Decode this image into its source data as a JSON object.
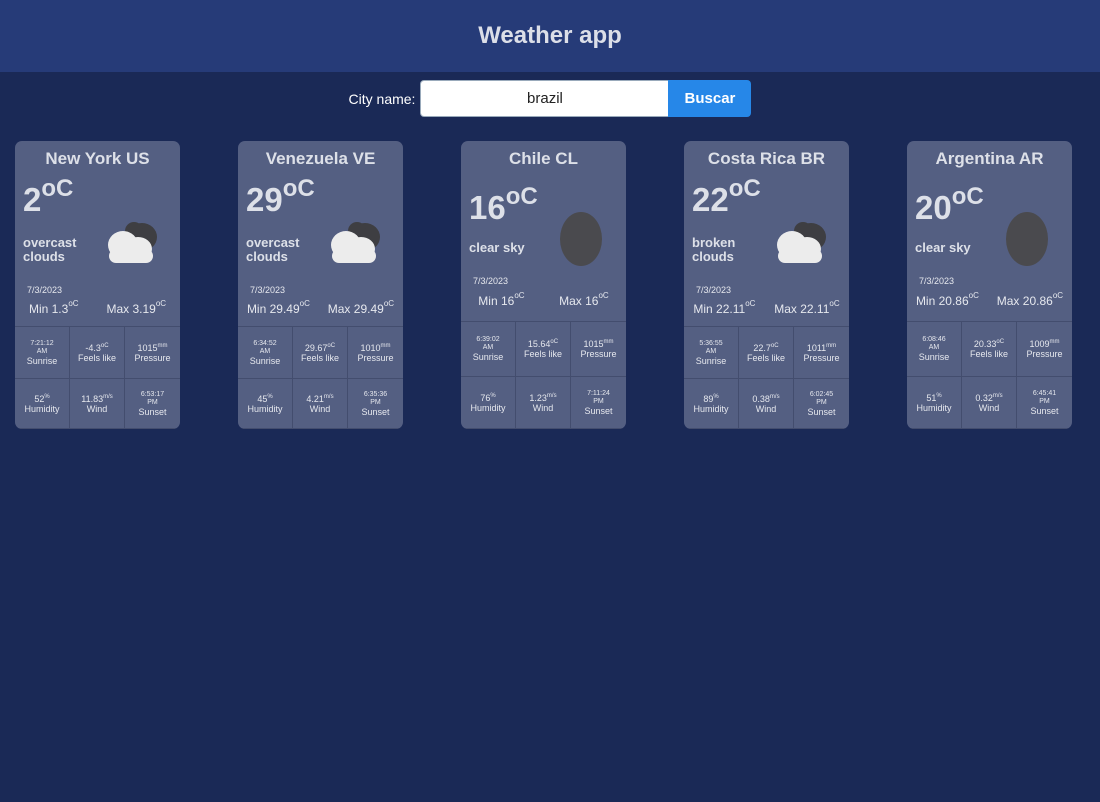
{
  "app": {
    "title": "Weather app"
  },
  "search": {
    "label": "City name:",
    "value": "brazil",
    "button": "Buscar"
  },
  "cards": [
    {
      "city": "New York US",
      "temp": "2",
      "unit": "oC",
      "desc": "overcast clouds",
      "icon": "cloud-icon",
      "date": "7/3/2023",
      "min": "Min 1.3",
      "max": "Max 3.19",
      "deg": "oC",
      "sunrise_time": "7:21:12",
      "sunrise_ampm": "AM",
      "sunrise_label": "Sunrise",
      "feels": "-4.3",
      "feels_unit": "oC",
      "feels_label": "Feels like",
      "pressure": "1015",
      "pressure_unit": "mm",
      "pressure_label": "Pressure",
      "humidity": "52",
      "humidity_unit": "%",
      "humidity_label": "Humidity",
      "wind": "11.83",
      "wind_unit": "m/s",
      "wind_label": "Wind",
      "sunset_time": "6:53:17",
      "sunset_ampm": "PM",
      "sunset_label": "Sunset"
    },
    {
      "city": "Venezuela VE",
      "temp": "29",
      "unit": "oC",
      "desc": "overcast clouds",
      "icon": "cloud-icon",
      "date": "7/3/2023",
      "min": "Min 29.49",
      "max": "Max 29.49",
      "deg": "oC",
      "sunrise_time": "6:34:52",
      "sunrise_ampm": "AM",
      "sunrise_label": "Sunrise",
      "feels": "29.67",
      "feels_unit": "oC",
      "feels_label": "Feels like",
      "pressure": "1010",
      "pressure_unit": "mm",
      "pressure_label": "Pressure",
      "humidity": "45",
      "humidity_unit": "%",
      "humidity_label": "Humidity",
      "wind": "4.21",
      "wind_unit": "m/s",
      "wind_label": "Wind",
      "sunset_time": "6:35:36",
      "sunset_ampm": "PM",
      "sunset_label": "Sunset"
    },
    {
      "city": "Chile CL",
      "temp": "16",
      "unit": "oC",
      "desc": "clear sky",
      "icon": "clear-sky-icon",
      "date": "7/3/2023",
      "min": "Min 16",
      "max": "Max 16",
      "deg": "oC",
      "sunrise_time": "6:39:02",
      "sunrise_ampm": "AM",
      "sunrise_label": "Sunrise",
      "feels": "15.64",
      "feels_unit": "oC",
      "feels_label": "Feels like",
      "pressure": "1015",
      "pressure_unit": "mm",
      "pressure_label": "Pressure",
      "humidity": "76",
      "humidity_unit": "%",
      "humidity_label": "Humidity",
      "wind": "1.23",
      "wind_unit": "m/s",
      "wind_label": "Wind",
      "sunset_time": "7:11:24",
      "sunset_ampm": "PM",
      "sunset_label": "Sunset"
    },
    {
      "city": "Costa Rica BR",
      "temp": "22",
      "unit": "oC",
      "desc": "broken clouds",
      "icon": "cloud-icon",
      "date": "7/3/2023",
      "min": "Min 22.11",
      "max": "Max 22.11",
      "deg": "oC",
      "sunrise_time": "5:36:55",
      "sunrise_ampm": "AM",
      "sunrise_label": "Sunrise",
      "feels": "22.7",
      "feels_unit": "oC",
      "feels_label": "Feels like",
      "pressure": "1011",
      "pressure_unit": "mm",
      "pressure_label": "Pressure",
      "humidity": "89",
      "humidity_unit": "%",
      "humidity_label": "Humidity",
      "wind": "0.38",
      "wind_unit": "m/s",
      "wind_label": "Wind",
      "sunset_time": "6:02:45",
      "sunset_ampm": "PM",
      "sunset_label": "Sunset"
    },
    {
      "city": "Argentina AR",
      "temp": "20",
      "unit": "oC",
      "desc": "clear sky",
      "icon": "clear-sky-icon",
      "date": "7/3/2023",
      "min": "Min 20.86",
      "max": "Max 20.86",
      "deg": "oC",
      "sunrise_time": "6:08:46",
      "sunrise_ampm": "AM",
      "sunrise_label": "Sunrise",
      "feels": "20.33",
      "feels_unit": "oC",
      "feels_label": "Feels like",
      "pressure": "1009",
      "pressure_unit": "mm",
      "pressure_label": "Pressure",
      "humidity": "51",
      "humidity_unit": "%",
      "humidity_label": "Humidity",
      "wind": "0.32",
      "wind_unit": "m/s",
      "wind_label": "Wind",
      "sunset_time": "6:45:41",
      "sunset_ampm": "PM",
      "sunset_label": "Sunset"
    }
  ]
}
